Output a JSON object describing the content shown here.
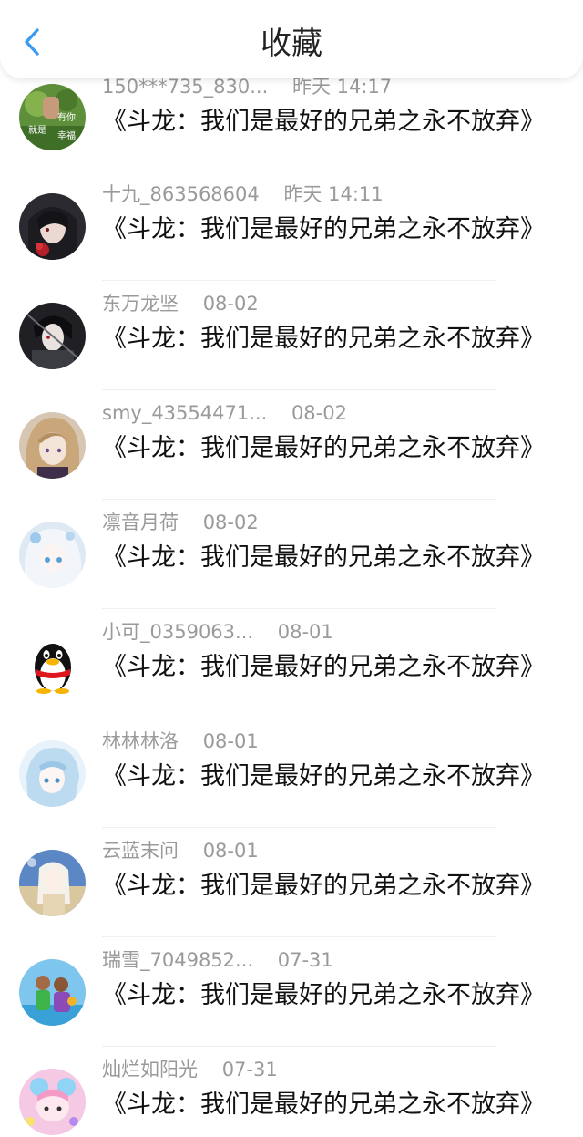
{
  "header": {
    "title": "收藏",
    "back_icon": "chevron-left-icon",
    "accent_color": "#3a9bf5"
  },
  "items": [
    {
      "user": "150***735_830...",
      "time": "昨天 14:17",
      "title": "《斗龙：我们是最好的兄弟之永不放弃》",
      "avatar": "green-avatar-with-text",
      "avatar_text": [
        "有你",
        "就是",
        "幸福"
      ]
    },
    {
      "user": "十九_863568604",
      "time": "昨天 14:11",
      "title": "《斗龙：我们是最好的兄弟之永不放弃》",
      "avatar": "dark-anime-girl-avatar"
    },
    {
      "user": "东万龙坚",
      "time": "08-02",
      "title": "《斗龙：我们是最好的兄弟之永不放弃》",
      "avatar": "dark-anime-boy-avatar"
    },
    {
      "user": "smy_43554471...",
      "time": "08-02",
      "title": "《斗龙：我们是最好的兄弟之永不放弃》",
      "avatar": "blonde-anime-avatar"
    },
    {
      "user": "凛音月荷",
      "time": "08-02",
      "title": "《斗龙：我们是最好的兄弟之永不放弃》",
      "avatar": "white-hair-anime-avatar"
    },
    {
      "user": "小可_0359063...",
      "time": "08-01",
      "title": "《斗龙：我们是最好的兄弟之永不放弃》",
      "avatar": "qq-penguin-avatar"
    },
    {
      "user": "林林林洛",
      "time": "08-01",
      "title": "《斗龙：我们是最好的兄弟之永不放弃》",
      "avatar": "light-blue-anime-avatar"
    },
    {
      "user": "云蓝末问",
      "time": "08-01",
      "title": "《斗龙：我们是最好的兄弟之永不放弃》",
      "avatar": "sky-anime-girl-avatar"
    },
    {
      "user": "瑞雪_7049852...",
      "time": "07-31",
      "title": "《斗龙：我们是最好的兄弟之永不放弃》",
      "avatar": "kids-photo-avatar"
    },
    {
      "user": "灿烂如阳光",
      "time": "07-31",
      "title": "《斗龙：我们是最好的兄弟之永不放弃》",
      "avatar": "pink-cartoon-avatar"
    }
  ]
}
